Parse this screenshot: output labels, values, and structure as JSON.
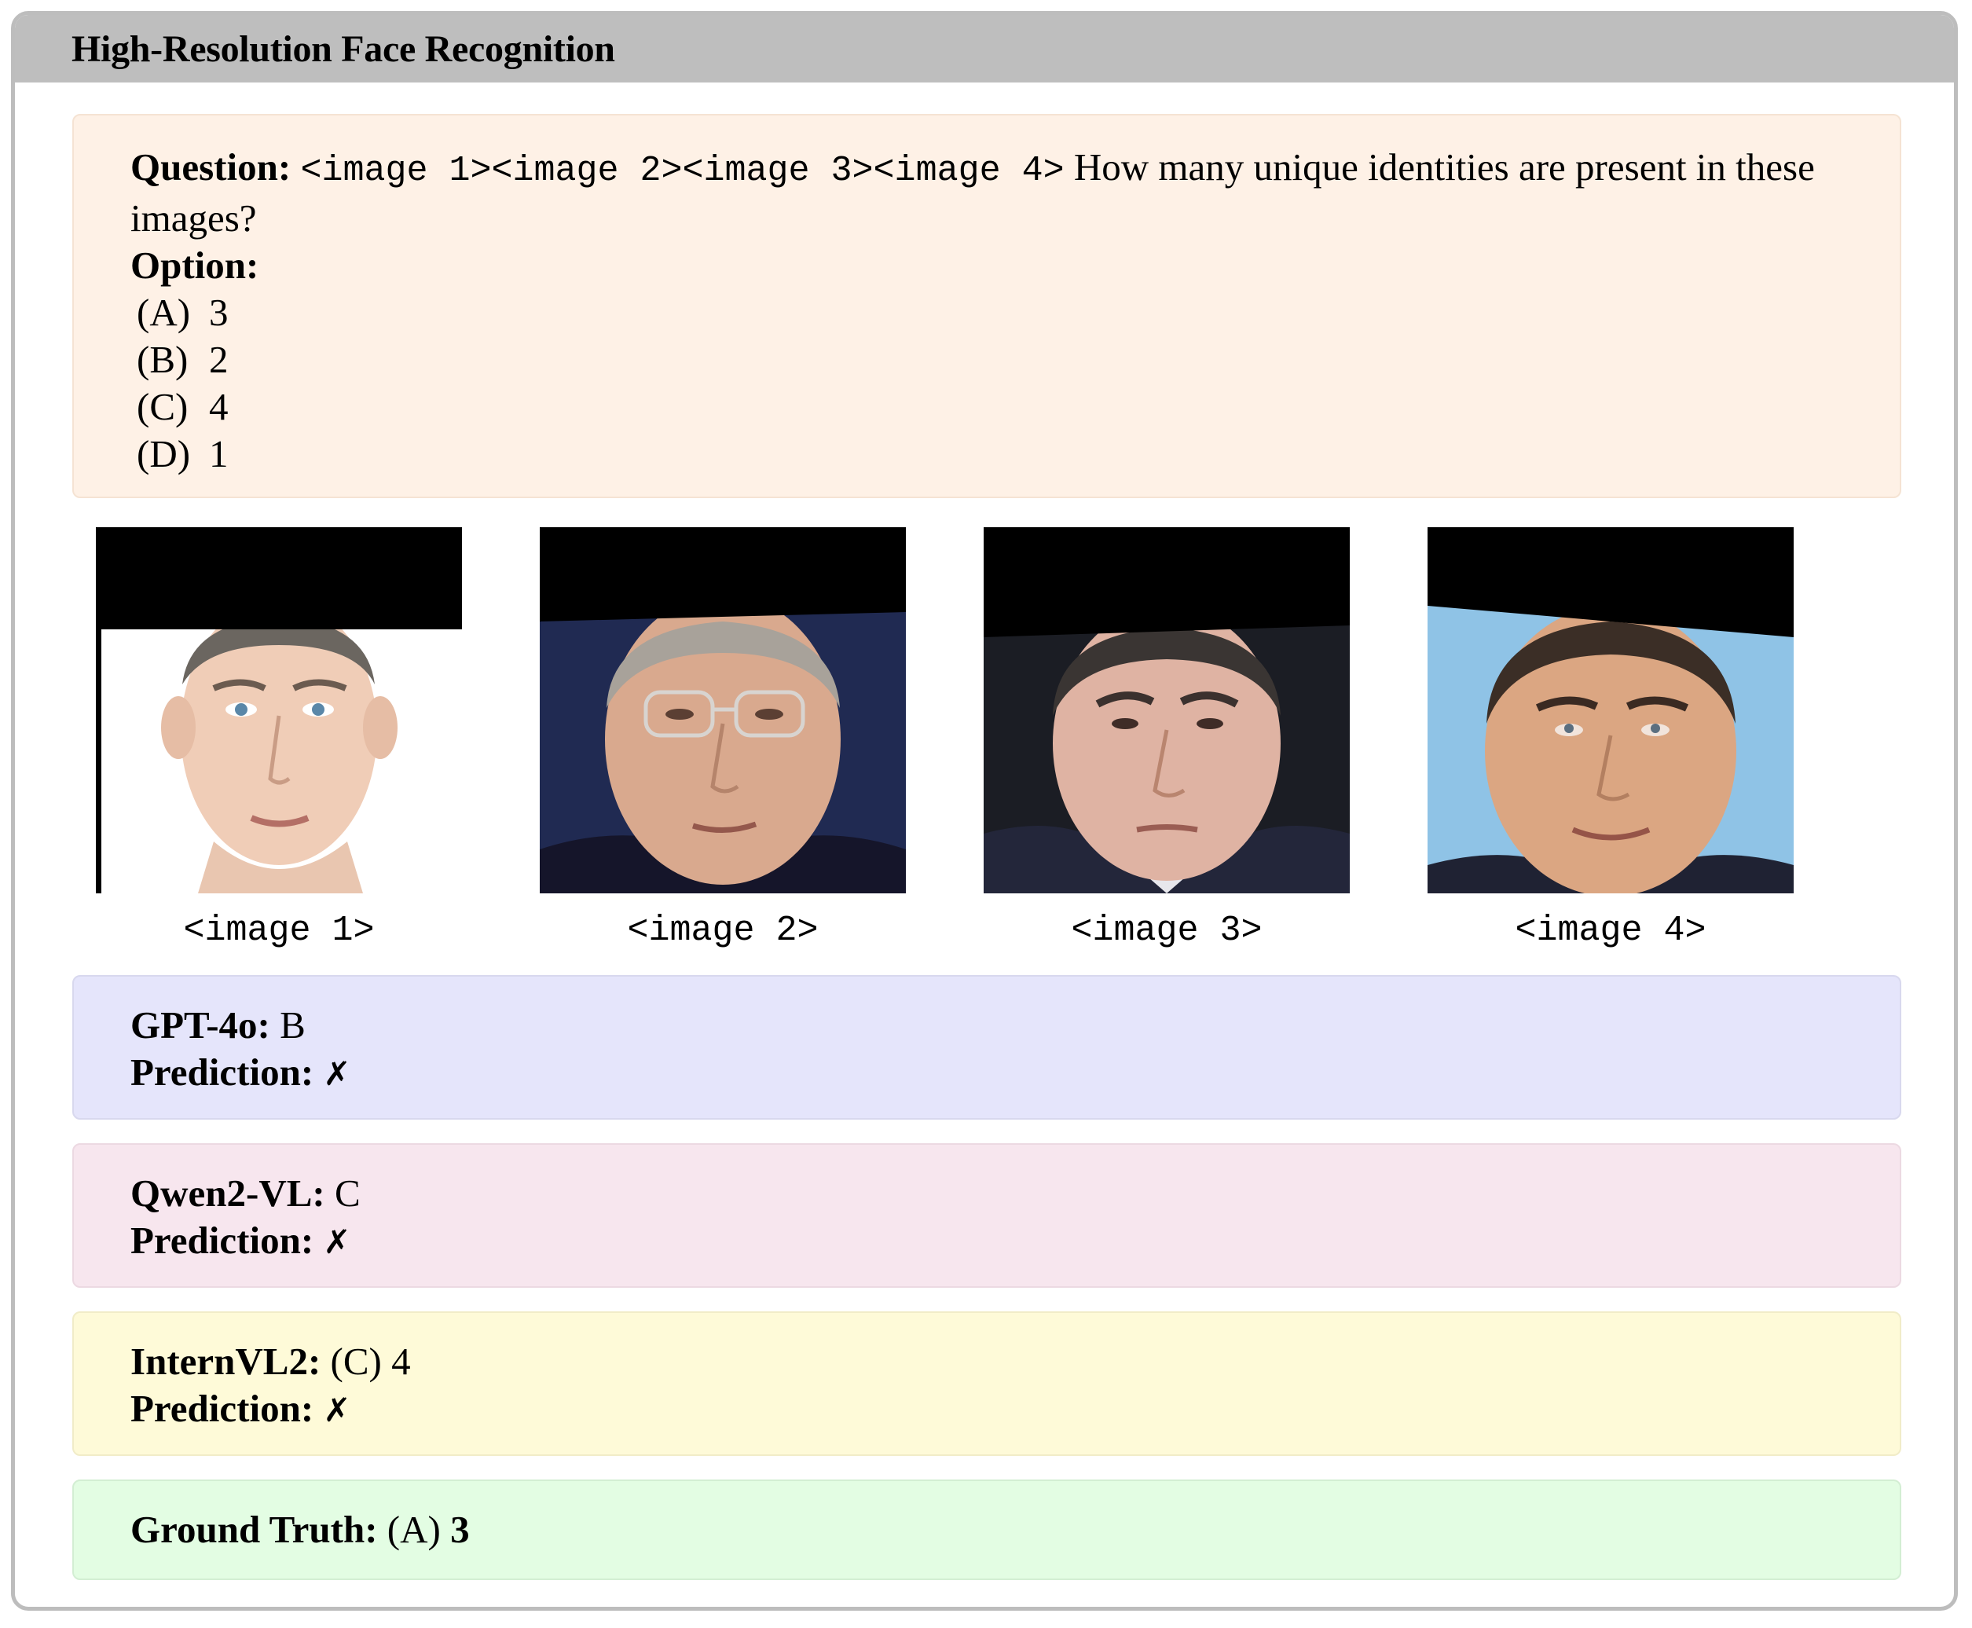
{
  "header": {
    "title": "High-Resolution Face Recognition"
  },
  "question": {
    "label": "Question:",
    "image_refs": "<image 1><image 2><image 3><image 4>",
    "text": "How many unique identities are present in these images?",
    "option_label": "Option:",
    "options": [
      {
        "key": "(A)",
        "value": "3"
      },
      {
        "key": "(B)",
        "value": "2"
      },
      {
        "key": "(C)",
        "value": "4"
      },
      {
        "key": "(D)",
        "value": "1"
      }
    ]
  },
  "images": [
    {
      "caption": "<image 1>",
      "background": "#ffffff"
    },
    {
      "caption": "<image 2>",
      "background": "#202a52"
    },
    {
      "caption": "<image 3>",
      "background": "#1b1d24"
    },
    {
      "caption": "<image 4>",
      "background": "#8fc3e6"
    }
  ],
  "predictions": [
    {
      "model": "GPT-4o:",
      "answer": "B",
      "prediction_label": "Prediction:",
      "mark": "✗"
    },
    {
      "model": "Qwen2-VL:",
      "answer": "C",
      "prediction_label": "Prediction:",
      "mark": "✗"
    },
    {
      "model": "InternVL2:",
      "answer": "(C) 4",
      "prediction_label": "Prediction:",
      "mark": "✗"
    }
  ],
  "ground_truth": {
    "label": "Ground Truth:",
    "answer_key": "(A)",
    "answer_value": "3"
  },
  "colors": {
    "question_bg": "#fef1e6",
    "gpt_bg": "#e5e5fb",
    "qwen_bg": "#f7e6ee",
    "intern_bg": "#fefad8",
    "ground_truth_bg": "#e3fde3",
    "header_bg": "#bebebe"
  }
}
